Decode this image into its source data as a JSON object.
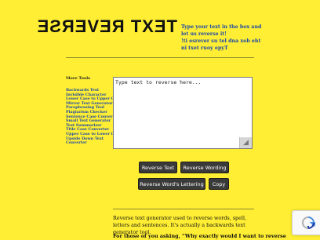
{
  "header": {
    "logo_text": "TEXT REVERSE",
    "tagline_line1": "Type your text in the box and let us reverse it!",
    "tagline_line2": "!ti esrever su tel dna xob eht ni txet ruoy epyT"
  },
  "sidebar": {
    "title": "More Tools",
    "items": [
      "Backwards Text",
      "Invisible Character",
      "Lower Case to Upper Case",
      "Mirror Text Generator",
      "Paraphrasing Tool",
      "Plagiarism Checker",
      "Sentence Case Converter",
      "Small Text Generator",
      "Text Summarizer",
      "Title Case Converter",
      "Upper Case to Lower Case",
      "Upside Down Text",
      "Converter"
    ]
  },
  "editor": {
    "placeholder": "Type text to reverse here..."
  },
  "buttons": {
    "reverse_text": "Reverse Text",
    "reverse_wording": "Reverse Wording",
    "reverse_lettering": "Reverse Word's Lettering",
    "copy": "Copy"
  },
  "content": {
    "description": "Reverse text generator used to reverse words, spell, letters and sentences. It's actually a backwards text generator tool.",
    "question": "For those of you asking, “Why exactly would I want to reverse"
  },
  "colors": {
    "background": "#ffee33",
    "link": "#1a47a8",
    "button": "#3a3a3a"
  }
}
